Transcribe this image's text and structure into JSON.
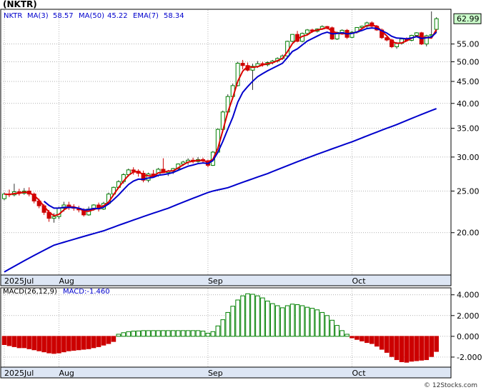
{
  "title": "(NKTR)",
  "legend": {
    "ticker": "NKTR",
    "ma3": "MA(3)",
    "ma3_val": "58.57",
    "ma50": "MA(50)",
    "ma50_val": "45.22",
    "ema7": "EMA(7)",
    "ema7_val": "58.34"
  },
  "price_label": "62.99",
  "macd_legend": {
    "name": "MACD(26,12,9)",
    "value": "MACD:-1.460"
  },
  "copyright": "© 12Stocks.com",
  "colors": {
    "up": "#008000",
    "down": "#cc0000",
    "ma": "#0000cc",
    "ema": "#dd0000",
    "axis_band": "#dde6f4",
    "grid": "#999999",
    "price_box": "#ccffcc"
  },
  "chart_data": [
    {
      "type": "candlestick",
      "title": "(NKTR)",
      "y_scale": "log",
      "ylim": [
        16,
        66
      ],
      "yticks": [
        "55.00",
        "50.00",
        "45.00",
        "40.00",
        "35.00",
        "30.00",
        "25.00",
        "20.00"
      ],
      "ytick_values": [
        55,
        50,
        45,
        40,
        35,
        30,
        25,
        20
      ],
      "x_labels": [
        {
          "label": "2025Jul",
          "index": 0
        },
        {
          "label": "Aug",
          "index": 11
        },
        {
          "label": "Sep",
          "index": 41
        },
        {
          "label": "Oct",
          "index": 70
        }
      ],
      "x_count": 88,
      "last_price": 62.99,
      "candles": [
        [
          24.0,
          24.8,
          23.8,
          24.6
        ],
        [
          24.6,
          25.2,
          24.2,
          24.5
        ],
        [
          24.5,
          26.0,
          24.3,
          24.9
        ],
        [
          24.9,
          25.3,
          24.4,
          24.7
        ],
        [
          24.7,
          25.4,
          24.5,
          25.0
        ],
        [
          25.0,
          25.5,
          24.3,
          24.6
        ],
        [
          24.6,
          24.8,
          23.4,
          23.7
        ],
        [
          23.7,
          24.0,
          22.8,
          23.1
        ],
        [
          23.1,
          23.3,
          22.0,
          22.3
        ],
        [
          22.3,
          22.6,
          21.2,
          21.6
        ],
        [
          21.6,
          22.2,
          21.1,
          21.8
        ],
        [
          21.8,
          23.0,
          21.5,
          22.8
        ],
        [
          22.8,
          23.6,
          22.4,
          23.2
        ],
        [
          23.2,
          23.6,
          22.6,
          22.9
        ],
        [
          22.9,
          23.3,
          22.5,
          22.8
        ],
        [
          22.8,
          23.1,
          22.3,
          22.6
        ],
        [
          22.6,
          22.8,
          21.8,
          22.0
        ],
        [
          22.0,
          23.0,
          21.9,
          22.7
        ],
        [
          22.7,
          23.3,
          22.5,
          23.2
        ],
        [
          23.2,
          23.5,
          22.4,
          22.7
        ],
        [
          22.7,
          23.6,
          22.6,
          23.4
        ],
        [
          23.4,
          24.8,
          23.2,
          24.6
        ],
        [
          24.6,
          25.6,
          24.4,
          25.5
        ],
        [
          25.5,
          26.5,
          25.3,
          26.3
        ],
        [
          26.3,
          27.5,
          26.0,
          27.3
        ],
        [
          27.3,
          28.2,
          27.0,
          28.0
        ],
        [
          28.0,
          28.4,
          27.3,
          27.8
        ],
        [
          27.8,
          28.1,
          27.0,
          27.5
        ],
        [
          27.5,
          27.9,
          26.2,
          26.5
        ],
        [
          26.5,
          27.6,
          26.2,
          27.4
        ],
        [
          27.4,
          28.0,
          27.0,
          27.2
        ],
        [
          27.2,
          28.3,
          27.0,
          28.1
        ],
        [
          28.1,
          29.8,
          27.8,
          27.6
        ],
        [
          27.6,
          28.0,
          27.1,
          27.8
        ],
        [
          27.8,
          28.3,
          27.4,
          28.2
        ],
        [
          28.2,
          29.0,
          28.0,
          28.9
        ],
        [
          28.9,
          29.4,
          28.6,
          29.2
        ],
        [
          29.2,
          29.8,
          28.8,
          29.5
        ],
        [
          29.5,
          29.9,
          29.0,
          29.3
        ],
        [
          29.3,
          30.0,
          29.1,
          29.6
        ],
        [
          29.6,
          29.9,
          29.0,
          29.4
        ],
        [
          29.4,
          29.6,
          28.4,
          28.7
        ],
        [
          28.7,
          31.0,
          28.6,
          30.8
        ],
        [
          30.8,
          35.0,
          30.6,
          34.8
        ],
        [
          34.8,
          38.5,
          34.5,
          38.2
        ],
        [
          38.2,
          42.0,
          38.0,
          41.5
        ],
        [
          41.5,
          44.5,
          41.0,
          44.0
        ],
        [
          44.0,
          50.0,
          43.8,
          49.6
        ],
        [
          49.6,
          50.5,
          48.0,
          49.0
        ],
        [
          49.0,
          49.8,
          47.5,
          47.8
        ],
        [
          47.8,
          49.5,
          43.0,
          48.8
        ],
        [
          48.8,
          50.2,
          48.4,
          49.5
        ],
        [
          49.5,
          50.0,
          48.7,
          49.2
        ],
        [
          49.2,
          50.1,
          48.8,
          49.8
        ],
        [
          49.8,
          50.5,
          49.3,
          50.2
        ],
        [
          50.2,
          51.2,
          49.8,
          50.9
        ],
        [
          50.9,
          52.0,
          50.5,
          51.6
        ],
        [
          51.6,
          56.0,
          51.4,
          55.8
        ],
        [
          55.8,
          58.0,
          55.5,
          57.9
        ],
        [
          57.9,
          59.0,
          55.5,
          55.8
        ],
        [
          55.8,
          58.5,
          55.5,
          58.2
        ],
        [
          58.2,
          59.6,
          57.8,
          59.3
        ],
        [
          59.3,
          59.7,
          58.4,
          58.9
        ],
        [
          58.9,
          59.8,
          58.5,
          59.6
        ],
        [
          59.6,
          60.8,
          59.3,
          60.4
        ],
        [
          60.4,
          60.6,
          59.5,
          60.0
        ],
        [
          60.0,
          60.4,
          56.2,
          56.5
        ],
        [
          56.5,
          58.8,
          56.2,
          58.5
        ],
        [
          58.5,
          59.5,
          58.2,
          59.2
        ],
        [
          59.2,
          59.6,
          56.5,
          57.0
        ],
        [
          57.0,
          59.0,
          56.8,
          58.6
        ],
        [
          58.6,
          60.2,
          58.2,
          60.1
        ],
        [
          60.1,
          60.7,
          59.6,
          60.5
        ],
        [
          60.5,
          62.0,
          60.0,
          61.6
        ],
        [
          61.6,
          62.1,
          60.2,
          60.5
        ],
        [
          60.5,
          60.9,
          59.0,
          59.3
        ],
        [
          59.3,
          59.8,
          56.5,
          56.9
        ],
        [
          56.9,
          57.4,
          55.8,
          56.2
        ],
        [
          56.2,
          56.6,
          53.8,
          54.2
        ],
        [
          54.2,
          55.6,
          53.6,
          55.2
        ],
        [
          55.2,
          56.8,
          54.8,
          56.5
        ],
        [
          56.5,
          57.0,
          55.8,
          56.1
        ],
        [
          56.1,
          57.8,
          55.8,
          57.6
        ],
        [
          57.6,
          58.6,
          57.2,
          58.4
        ],
        [
          58.4,
          58.7,
          54.7,
          55.0
        ],
        [
          55.0,
          57.8,
          54.3,
          57.5
        ],
        [
          57.5,
          65.5,
          57.0,
          57.8
        ],
        [
          59.5,
          63.5,
          58.5,
          62.99
        ]
      ],
      "ma50": [
        16.2,
        16.45,
        16.7,
        16.95,
        17.2,
        17.45,
        17.7,
        17.95,
        18.2,
        18.45,
        18.7,
        18.85,
        19.0,
        19.15,
        19.3,
        19.45,
        19.6,
        19.75,
        19.9,
        20.05,
        20.2,
        20.4,
        20.6,
        20.8,
        21.0,
        21.2,
        21.4,
        21.6,
        21.8,
        22.0,
        22.2,
        22.4,
        22.6,
        22.8,
        23.05,
        23.3,
        23.55,
        23.8,
        24.05,
        24.3,
        24.55,
        24.8,
        25.0,
        25.15,
        25.3,
        25.45,
        25.7,
        25.95,
        26.2,
        26.45,
        26.7,
        26.95,
        27.2,
        27.45,
        27.75,
        28.05,
        28.35,
        28.65,
        28.95,
        29.25,
        29.55,
        29.85,
        30.15,
        30.45,
        30.75,
        31.05,
        31.35,
        31.65,
        31.95,
        32.25,
        32.55,
        32.9,
        33.25,
        33.6,
        33.95,
        34.3,
        34.65,
        35.0,
        35.35,
        35.7,
        36.1,
        36.5,
        36.9,
        37.3,
        37.7,
        38.1,
        38.5,
        38.9
      ]
    },
    {
      "type": "bar",
      "title": "MACD(26,12,9)",
      "ylim": [
        -2.9,
        4.6
      ],
      "yticks": [
        "4.000",
        "2.000",
        "0.000",
        "-2.000"
      ],
      "ytick_values": [
        4,
        2,
        0,
        -2
      ],
      "x_labels": [
        {
          "label": "2025Jul",
          "index": 0
        },
        {
          "label": "Aug",
          "index": 11
        },
        {
          "label": "Sep",
          "index": 41
        },
        {
          "label": "Oct",
          "index": 70
        }
      ],
      "values": [
        -0.8,
        -0.9,
        -1.0,
        -1.1,
        -1.1,
        -1.2,
        -1.3,
        -1.4,
        -1.5,
        -1.6,
        -1.65,
        -1.6,
        -1.5,
        -1.4,
        -1.35,
        -1.3,
        -1.25,
        -1.2,
        -1.1,
        -1.0,
        -0.85,
        -0.7,
        -0.5,
        0.2,
        0.35,
        0.45,
        0.5,
        0.52,
        0.55,
        0.55,
        0.55,
        0.55,
        0.55,
        0.55,
        0.55,
        0.55,
        0.55,
        0.55,
        0.55,
        0.55,
        0.5,
        0.3,
        0.45,
        1.0,
        1.6,
        2.3,
        2.9,
        3.5,
        3.9,
        4.1,
        4.05,
        3.9,
        3.7,
        3.4,
        3.15,
        2.95,
        2.75,
        2.95,
        3.1,
        3.05,
        2.95,
        2.8,
        2.7,
        2.55,
        2.3,
        2.0,
        1.55,
        1.05,
        0.55,
        0.2,
        -0.15,
        -0.3,
        -0.45,
        -0.6,
        -0.7,
        -0.95,
        -1.25,
        -1.55,
        -1.95,
        -2.25,
        -2.45,
        -2.5,
        -2.4,
        -2.35,
        -2.3,
        -2.25,
        -1.95,
        -1.46
      ]
    }
  ]
}
